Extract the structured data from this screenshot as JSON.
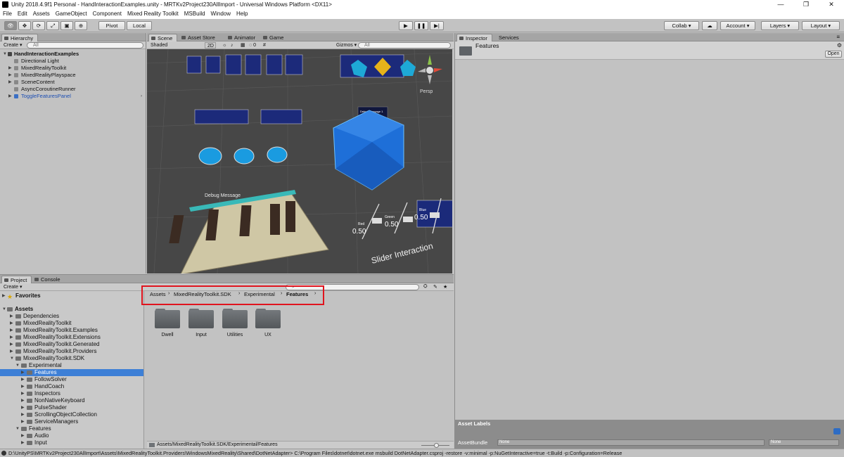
{
  "window": {
    "title": "Unity 2018.4.9f1 Personal - HandInteractionExamples.unity - MRTKv2Project230AllImport - Universal Windows Platform <DX11>",
    "controls": [
      "—",
      "❐",
      "✕"
    ]
  },
  "menu": [
    "File",
    "Edit",
    "Assets",
    "GameObject",
    "Component",
    "Mixed Reality Toolkit",
    "MSBuild",
    "Window",
    "Help"
  ],
  "toolbar": {
    "pivot": "Pivot",
    "local": "Local",
    "collab": "Collab ▾",
    "account": "Account",
    "layers": "Layers",
    "layout": "Layout"
  },
  "hierarchy": {
    "tab": "Hierarchy",
    "create": "Create ▾",
    "search_placeholder": "All",
    "scene": "HandInteractionExamples",
    "items": [
      "Directional Light",
      "MixedRealityToolkit",
      "MixedRealityPlayspace",
      "SceneContent",
      "AsyncCoroutineRunner",
      "ToggleFeaturesPanel"
    ]
  },
  "scene": {
    "tabs": [
      "Scene",
      "Asset Store",
      "Animator",
      "Game"
    ],
    "shading": "Shaded",
    "mode2d": "2D",
    "gizmos": "Gizmos ▾",
    "search_placeholder": "All",
    "persp": "Persp",
    "debug_message": "Debug Message",
    "debug_lines": [
      "Debug Message 1",
      "Debug Message 2"
    ],
    "slider_title": "Slider Interaction",
    "sliders": [
      {
        "label": "Red",
        "value": "0.50"
      },
      {
        "label": "Green",
        "value": "0.50"
      },
      {
        "label": "Blue",
        "value": "0.50"
      }
    ]
  },
  "inspector": {
    "tabs": [
      "Inspector",
      "Services"
    ],
    "object_name": "Features",
    "open_button": "Open",
    "asset_labels": "Asset Labels",
    "asset_bundle": "AssetBundle",
    "bundle_none": "None",
    "variant_none": "None"
  },
  "project": {
    "tabs": [
      "Project",
      "Console"
    ],
    "create": "Create ▾",
    "favorites": "Favorites",
    "assets": "Assets",
    "tree": [
      {
        "label": "Dependencies",
        "depth": 1
      },
      {
        "label": "MixedRealityToolkit",
        "depth": 1
      },
      {
        "label": "MixedRealityToolkit.Examples",
        "depth": 1
      },
      {
        "label": "MixedRealityToolkit.Extensions",
        "depth": 1
      },
      {
        "label": "MixedRealityToolkit.Generated",
        "depth": 1
      },
      {
        "label": "MixedRealityToolkit.Providers",
        "depth": 1
      },
      {
        "label": "MixedRealityToolkit.SDK",
        "depth": 1
      },
      {
        "label": "Experimental",
        "depth": 2
      },
      {
        "label": "Features",
        "depth": 3
      },
      {
        "label": "FollowSolver",
        "depth": 3
      },
      {
        "label": "HandCoach",
        "depth": 3
      },
      {
        "label": "Inspectors",
        "depth": 3
      },
      {
        "label": "NonNativeKeyboard",
        "depth": 3
      },
      {
        "label": "PulseShader",
        "depth": 3
      },
      {
        "label": "ScrollingObjectCollection",
        "depth": 3
      },
      {
        "label": "ServiceManagers",
        "depth": 3
      },
      {
        "label": "Features",
        "depth": 2
      },
      {
        "label": "Audio",
        "depth": 3
      },
      {
        "label": "Input",
        "depth": 3
      }
    ],
    "breadcrumb": [
      "Assets",
      "MixedRealityToolkit.SDK",
      "Experimental",
      "Features"
    ],
    "folders": [
      "Dwell",
      "Input",
      "Utilities",
      "UX"
    ],
    "path": "Assets/MixedRealityToolkit.SDK/Experimental/Features"
  },
  "status": "D:\\UnityPS\\MRTKv2Project230AllImport\\Assets\\MixedRealityToolkit.Providers\\WindowsMixedReality\\Shared\\DotNetAdapter> C:\\Program Files\\dotnet\\dotnet.exe msbuild DotNetAdapter.csproj -restore  -v:minimal -p:NuGetInteractive=true  -t:Build -p:Configuration=Release"
}
